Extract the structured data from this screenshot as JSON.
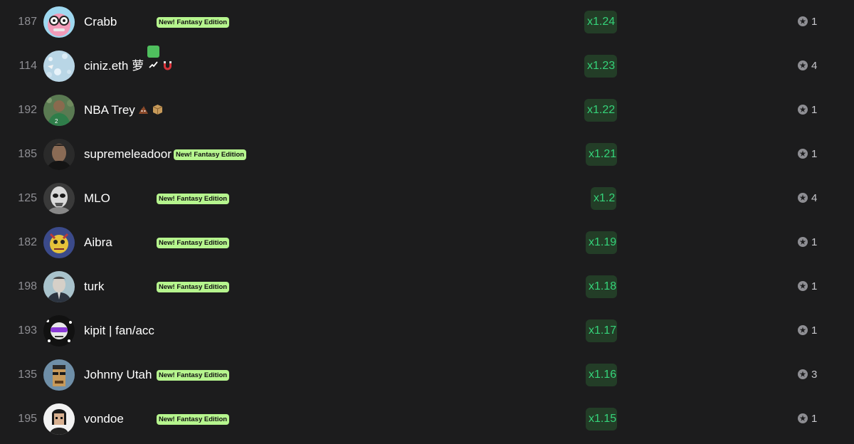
{
  "badge_text": "New! Fantasy Edition",
  "rows": [
    {
      "rank": "187",
      "name": "Crabb",
      "multiplier": "x1.24",
      "count": "1"
    },
    {
      "rank": "114",
      "name": "ciniz.eth 萝",
      "multiplier": "x1.23",
      "count": "4"
    },
    {
      "rank": "192",
      "name": "NBA Trey",
      "multiplier": "x1.22",
      "count": "1"
    },
    {
      "rank": "185",
      "name": "supremeleadoor",
      "multiplier": "x1.21",
      "count": "1"
    },
    {
      "rank": "125",
      "name": "MLO",
      "multiplier": "x1.2",
      "count": "4"
    },
    {
      "rank": "182",
      "name": "Aibra",
      "multiplier": "x1.19",
      "count": "1"
    },
    {
      "rank": "198",
      "name": "turk",
      "multiplier": "x1.18",
      "count": "1"
    },
    {
      "rank": "193",
      "name": "kipit | fan/acc",
      "multiplier": "x1.17",
      "count": "1"
    },
    {
      "rank": "135",
      "name": "Johnny Utah",
      "multiplier": "x1.16",
      "count": "3"
    },
    {
      "rank": "195",
      "name": "vondoe",
      "multiplier": "x1.15",
      "count": "1"
    }
  ],
  "colors": {
    "background": "#1c1c1d",
    "badge_bg": "#b6f58e",
    "multiplier_bg": "#233d27",
    "multiplier_text": "#35d37a"
  },
  "icons": {
    "bonus": "settings-dot-icon",
    "emoji_ciniz": [
      "chart-up-emoji-icon",
      "magnet-emoji-icon"
    ],
    "emoji_nba": [
      "poop-emoji-icon",
      "package-emoji-icon"
    ]
  }
}
